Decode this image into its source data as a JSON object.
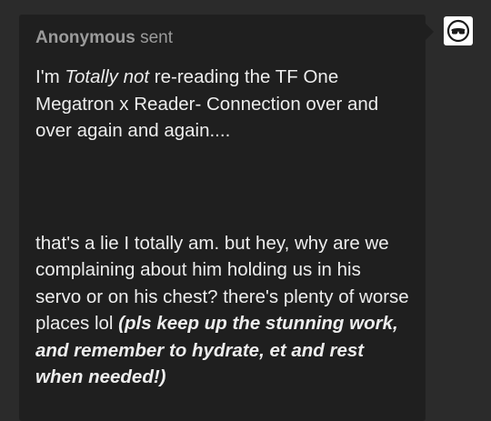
{
  "ask": {
    "sender_name": "Anonymous",
    "sender_verb": "sent",
    "paragraph1": {
      "before": "I'm ",
      "emphasis": "Totally not",
      "after": " re-reading the TF One Megatron x Reader- Connection over and over again and again...."
    },
    "paragraph2": {
      "plain": "that's a lie I totally am. but hey, why are we complaining about him holding us in his servo or on his chest? there's plenty of worse places lol ",
      "bold_italic": "(pls keep up the stunning work, and remember to hydrate, et and rest when needed!)"
    }
  },
  "avatar": {
    "icon": "anonymous-avatar-icon"
  }
}
